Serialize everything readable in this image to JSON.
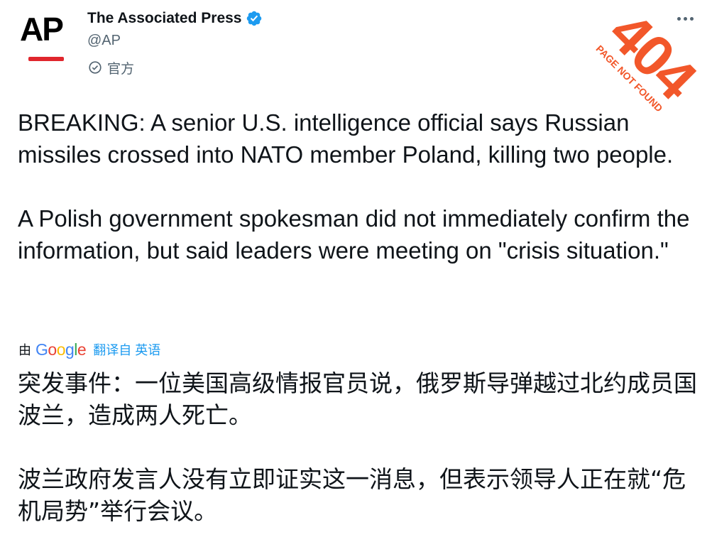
{
  "author": {
    "display_name": "The Associated Press",
    "handle": "@AP",
    "label": "官方",
    "avatar_text": "AP",
    "avatar_accent": "#e0262d",
    "verified_color": "#1d9bf0"
  },
  "icons": {
    "verified": "verified-badge-icon",
    "official": "official-check-icon",
    "more": "more-options-icon"
  },
  "stamp": {
    "big": "404",
    "small": "PAGE NOT FOUND",
    "color": "#f2572a"
  },
  "tweet": {
    "paragraph_1": "BREAKING: A senior U.S. intelligence official says Russian missiles crossed into NATO member Poland, killing two people.",
    "paragraph_2": "A Polish government spokesman did not immediately confirm the information, but said leaders were meeting on \"crisis situation.\""
  },
  "translation": {
    "by": "由",
    "provider": "Google",
    "link": "翻译自 英语",
    "paragraph_1": "突发事件：一位美国高级情报官员说，俄罗斯导弹越过北约成员国波兰，造成两人死亡。",
    "paragraph_2": "波兰政府发言人没有立即证实这一消息，但表示领导人正在就“危机局势”举行会议。"
  }
}
